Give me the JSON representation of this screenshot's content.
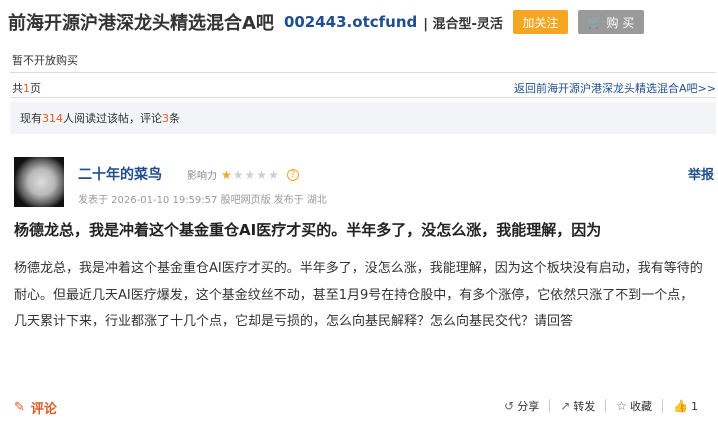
{
  "header": {
    "bar_title": "前海开源沪港深龙头精选混合A吧",
    "code_link": "002443.otcfund",
    "fund_type": "| 混合型-灵活",
    "follow_label": "加关注",
    "buy_label": "购 买"
  },
  "notice": "暂不开放购买",
  "pager": {
    "prefix": "共",
    "page": "1",
    "suffix": "页"
  },
  "back_link": "返回前海开源沪港深龙头精选混合A吧>>",
  "stats": {
    "prefix": "现有",
    "readers": "314",
    "mid": "人阅读过该帖，评论",
    "comments": "3",
    "suffix": "条"
  },
  "post": {
    "author": "二十年的菜鸟",
    "influence_label": "影响力",
    "influence_stars": 1,
    "influence_max": 5,
    "meta": "发表于 2026-01-10 19:59:57 股吧网页版 发布于 湖北",
    "report_label": "举报",
    "title": "杨德龙总，我是冲着这个基金重仓AI医疗才买的。半年多了，没怎么涨，我能理解，因为",
    "body": "杨德龙总，我是冲着这个基金重仓AI医疗才买的。半年多了，没怎么涨，我能理解，因为这个板块没有启动，我有等待的耐心。但最近几天AI医疗爆发，这个基金纹丝不动，甚至1月9号在持仓股中，有多个涨停，它依然只涨了不到一个点，几天累计下来，行业都涨了十几个点，它却是亏损的，怎么向基民解释？怎么向基民交代？请回答"
  },
  "footer": {
    "comment_label": "评论",
    "share_label": "分享",
    "repost_label": "转发",
    "collect_label": "收藏",
    "like_count": "1"
  },
  "colors": {
    "accent": "#e05a24",
    "link": "#1f4e8f",
    "follow": "#f5a623"
  },
  "icons": [
    "cart-icon",
    "star-icon",
    "help-icon",
    "pencil-icon",
    "share-icon",
    "repost-icon",
    "collect-star-icon",
    "thumb-up-icon"
  ]
}
